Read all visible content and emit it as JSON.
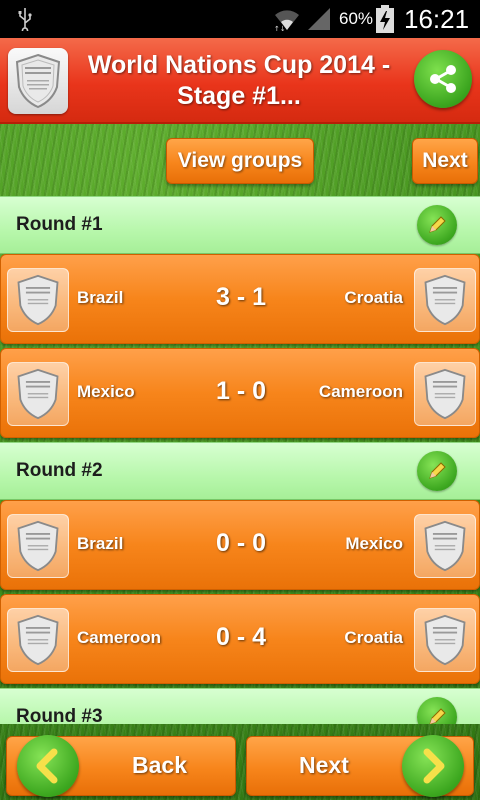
{
  "status_bar": {
    "battery": "60%",
    "time": "16:21"
  },
  "header": {
    "title": "World Nations Cup 2014 - Stage #1..."
  },
  "toolbar": {
    "view_groups_label": "View groups",
    "next_label": "Next"
  },
  "rounds": [
    {
      "label": "Round #1",
      "matches": [
        {
          "home": "Brazil",
          "score": "3 - 1",
          "away": "Croatia"
        },
        {
          "home": "Mexico",
          "score": "1 - 0",
          "away": "Cameroon"
        }
      ]
    },
    {
      "label": "Round #2",
      "matches": [
        {
          "home": "Brazil",
          "score": "0 - 0",
          "away": "Mexico"
        },
        {
          "home": "Cameroon",
          "score": "0 - 4",
          "away": "Croatia"
        }
      ]
    },
    {
      "label": "Round #3",
      "matches": []
    }
  ],
  "bottom_nav": {
    "back_label": "Back",
    "next_label": "Next"
  },
  "colors": {
    "header": "#e9351b",
    "accent_orange": "#f7851b",
    "round_bg": "#b8f7ac",
    "green_button": "#3ca71f"
  },
  "icons": {
    "status": [
      "usb-icon",
      "wifi-icon",
      "signal-icon",
      "battery-icon"
    ],
    "share": "share-icon",
    "edit": "pencil-icon",
    "placeholder_logo": "shield-icon"
  }
}
